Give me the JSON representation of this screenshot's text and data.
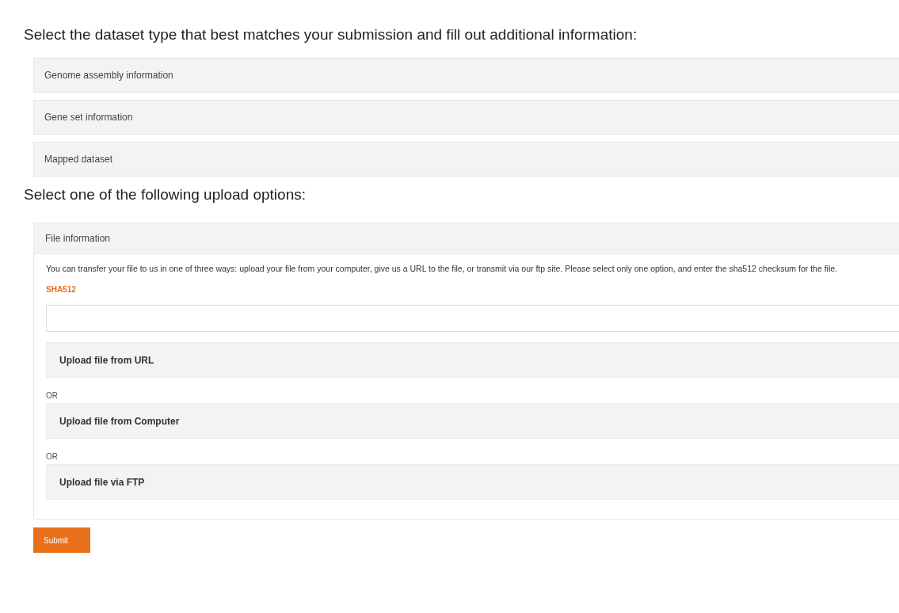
{
  "heading": "Select the dataset type that best matches your submission and fill out additional information:",
  "dataset_types": [
    {
      "label": "Genome assembly information"
    },
    {
      "label": "Gene set information"
    },
    {
      "label": "Mapped dataset"
    }
  ],
  "upload_heading": "Select one of the following upload options:",
  "file_panel": {
    "title": "File information",
    "description": "You can transfer your file to us in one of three ways: upload your file from your computer, give us a URL to the file, or transmit via our ftp site. Please select only one option, and enter the sha512 checksum for the file.",
    "sha_label": "SHA512",
    "options": [
      {
        "label": "Upload file from URL"
      },
      {
        "separator": "OR",
        "label": "Upload file from Computer"
      },
      {
        "separator": "OR",
        "label": "Upload file via FTP"
      }
    ]
  },
  "submit": "Submit"
}
